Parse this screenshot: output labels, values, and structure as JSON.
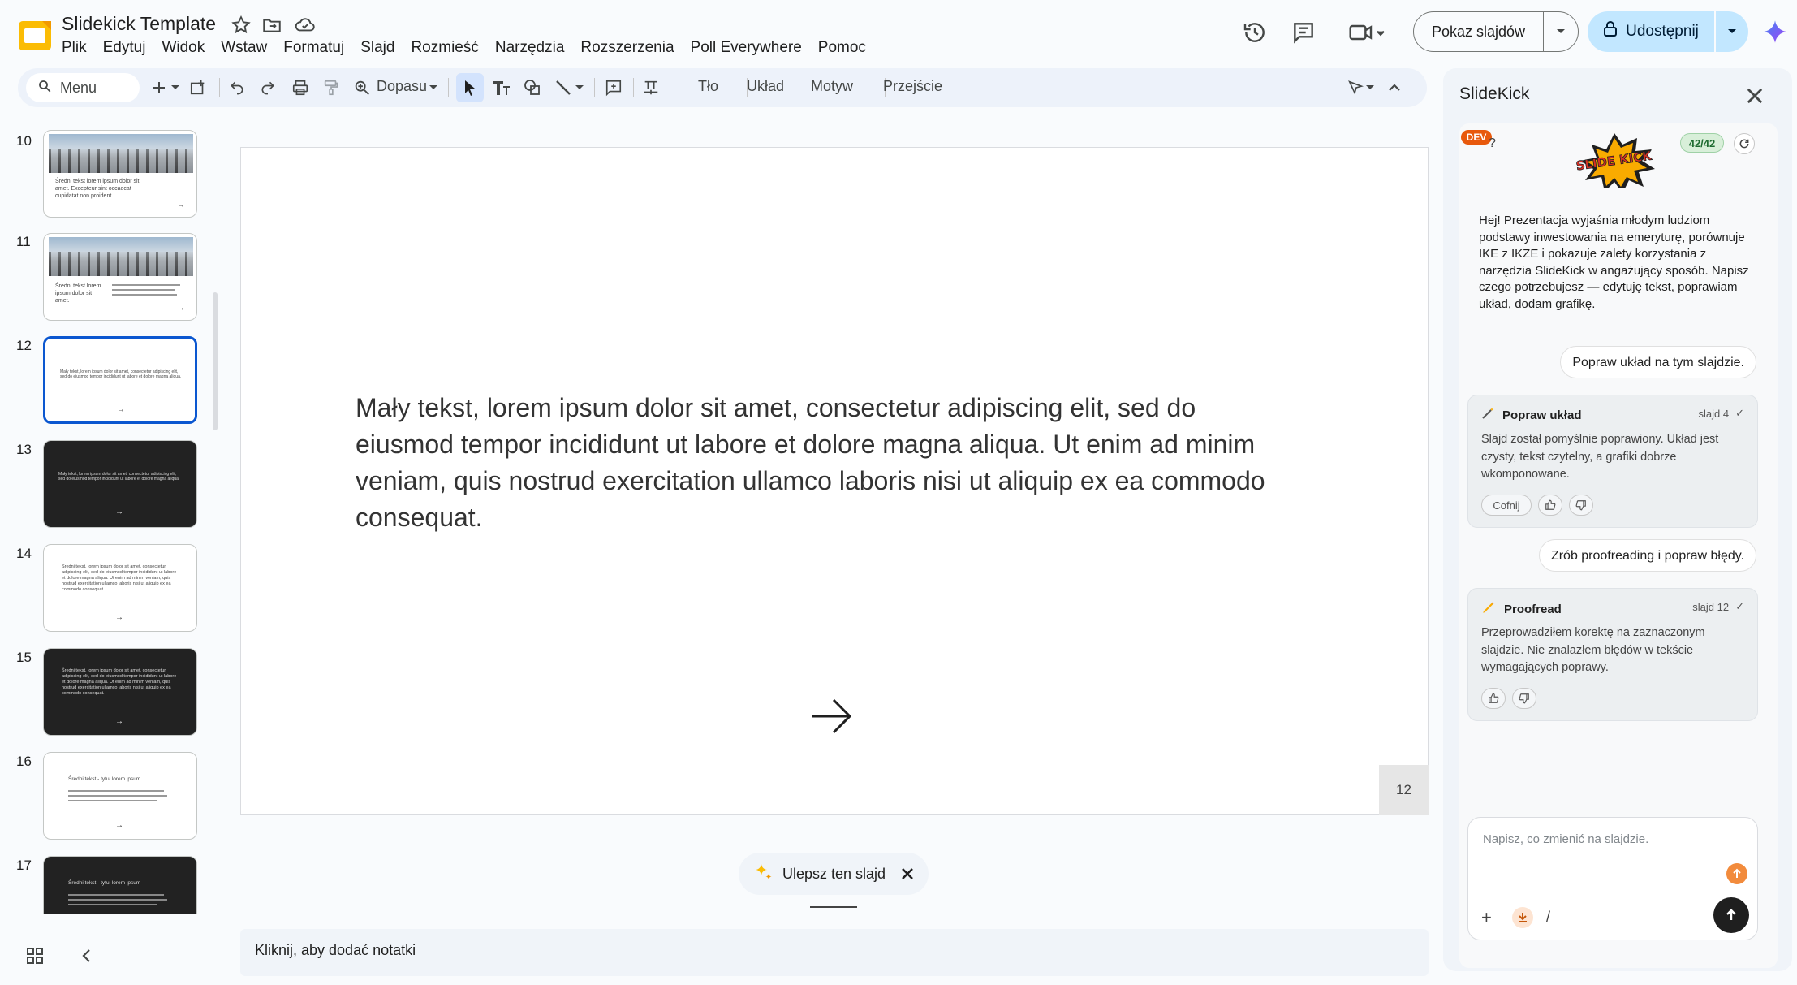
{
  "app": {
    "title": "Slidekick Template",
    "menu": [
      "Plik",
      "Edytuj",
      "Widok",
      "Wstaw",
      "Formatuj",
      "Slajd",
      "Rozmieść",
      "Narzędzia",
      "Rozszerzenia",
      "Poll Everywhere",
      "Pomoc"
    ],
    "present_label": "Pokaz slajdów",
    "share_label": "Udostępnij",
    "accent": "#0b57d0",
    "logo_color": "#fbbc04"
  },
  "toolbar": {
    "search_label": "Menu",
    "zoom_label": "Dopasu",
    "background_label": "Tło",
    "layout_label": "Układ",
    "theme_label": "Motyw",
    "transition_label": "Przejście"
  },
  "filmstrip": {
    "slides": [
      {
        "number": "10",
        "text": "Średni tekst lorem ipsum dolor sit amet. Excepteur sint occaecat cupidatat non proident"
      },
      {
        "number": "11",
        "text": "Średni tekst lorem ipsum dolor sit amet."
      },
      {
        "number": "12",
        "text": "Mały tekst, lorem ipsum dolor sit amet, consectetur adipiscing elit, sed do eiusmod tempor incididunt ut labore et dolore magna aliqua."
      },
      {
        "number": "13",
        "text": "Mały tekst, lorem ipsum dolor sit amet, consectetur adipiscing elit, sed do eiusmod tempor incididunt ut labore et dolore magna aliqua."
      },
      {
        "number": "14",
        "text": "Średni tekst, lorem ipsum dolor sit amet, consectetur adipiscing elit, sed do eiusmod tempor incididunt ut labore et dolore magna aliqua. Ut enim ad minim veniam, quis nostrud exercitation ullamco laboris nisi ut aliquip ex ea commodo consequat."
      },
      {
        "number": "15",
        "text": "Średni tekst, lorem ipsum dolor sit amet, consectetur adipiscing elit, sed do eiusmod tempor incididunt ut labore et dolore magna aliqua. Ut enim ad minim veniam, quis nostrud exercitation ullamco laboris nisi ut aliquip ex ea commodo consequat."
      },
      {
        "number": "16",
        "text": "Średni tekst - tytuł lorem ipsum"
      },
      {
        "number": "17",
        "text": "Średni tekst - tytuł lorem ipsum"
      }
    ]
  },
  "slide": {
    "body": "Mały tekst, lorem ipsum dolor sit amet, consectetur adipiscing elit, sed do eiusmod tempor incididunt ut labore et dolore magna aliqua. Ut enim ad minim veniam, quis nostrud exercitation ullamco laboris nisi ut aliquip ex ea commodo consequat.",
    "page_number": "12"
  },
  "improve_label": "Ulepsz ten slajd",
  "notes_placeholder": "Kliknij, aby dodać notatki",
  "panel": {
    "title": "SlideKick",
    "dev_badge": "DEV",
    "help": "?",
    "logo_text": "SLIDE KICK",
    "credits": "42/42",
    "intro": "Hej! Prezentacja wyjaśnia młodym ludziom podstawy inwestowania na emeryturę, porównuje IKE z IKZE i pokazuje zalety korzystania z narzędzia SlideKick w angażujący sposób. Napisz czego potrzebujesz — edytuję tekst, poprawiam układ, dodam grafikę.",
    "user_msg_1": "Popraw układ na tym slajdzie.",
    "card1": {
      "title": "Popraw układ",
      "meta": "slajd 4",
      "body": "Slajd został pomyślnie poprawiony. Układ jest czysty, tekst czytelny, a grafiki dobrze wkomponowane.",
      "undo": "Cofnij"
    },
    "user_msg_2": "Zrób proofreading i popraw błędy.",
    "card2": {
      "title": "Proofread",
      "meta": "slajd 12",
      "body": "Przeprowadziłem korektę na zaznaczonym slajdzie. Nie znalazłem błędów w tekście wymagających poprawy."
    },
    "composer_placeholder": "Napisz, co zmienić na slajdzie.",
    "slash": "/"
  }
}
